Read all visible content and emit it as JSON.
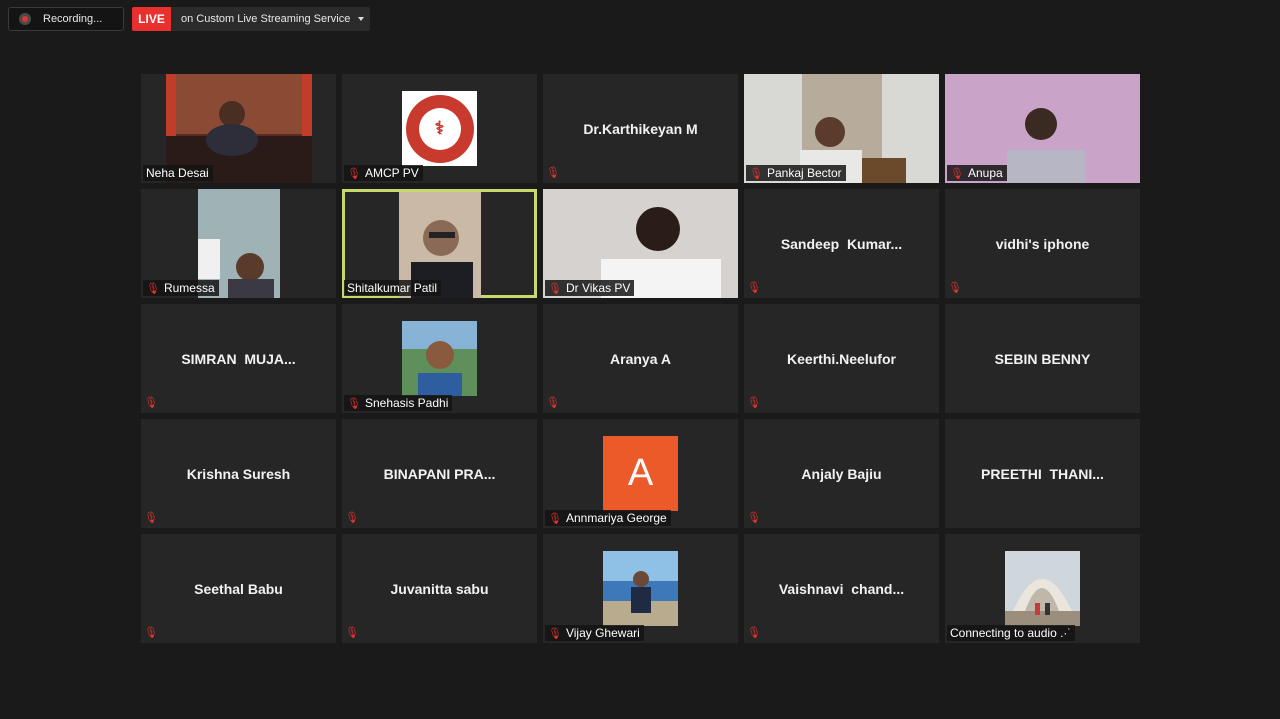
{
  "topbar": {
    "recording_label": "Recording...",
    "live_badge": "LIVE",
    "live_service": "on Custom Live Streaming Service"
  },
  "colors": {
    "live_red": "#e8312f",
    "active_border": "#c7d96c",
    "tile_bg": "#262626"
  },
  "participants": [
    {
      "name": "Neha Desai",
      "label": "Neha Desai",
      "muted": false,
      "kind": "video"
    },
    {
      "name": "AMCP PV",
      "label": "AMCP PV",
      "muted": true,
      "kind": "logo"
    },
    {
      "name": "Dr.Karthikeyan M",
      "muted": true,
      "kind": "name"
    },
    {
      "name": "Pankaj Bector",
      "label": "Pankaj Bector",
      "muted": true,
      "kind": "video"
    },
    {
      "name": "Anupa",
      "label": "Anupa",
      "muted": true,
      "kind": "video"
    },
    {
      "name": "Rumessa",
      "label": "Rumessa",
      "muted": true,
      "kind": "video"
    },
    {
      "name": "Shitalkumar Patil",
      "label": "Shitalkumar Patil",
      "muted": false,
      "kind": "video",
      "active_speaker": true
    },
    {
      "name": "Dr Vikas PV",
      "label": "Dr Vikas PV",
      "muted": true,
      "kind": "video"
    },
    {
      "name": "Sandeep  Kumar...",
      "muted": true,
      "kind": "name"
    },
    {
      "name": "vidhi's iphone",
      "muted": true,
      "kind": "name"
    },
    {
      "name": "SIMRAN  MUJA...",
      "muted": true,
      "kind": "name"
    },
    {
      "name": "Snehasis Padhi",
      "label": "Snehasis Padhi",
      "muted": true,
      "kind": "photo"
    },
    {
      "name": "Aranya A",
      "muted": true,
      "kind": "name"
    },
    {
      "name": "Keerthi.Neelufor",
      "muted": true,
      "kind": "name"
    },
    {
      "name": "SEBIN BENNY",
      "muted": false,
      "kind": "name"
    },
    {
      "name": "Krishna Suresh",
      "muted": true,
      "kind": "name"
    },
    {
      "name": "BINAPANI PRA...",
      "muted": true,
      "kind": "name"
    },
    {
      "name": "Annmariya George",
      "label": "Annmariya George",
      "muted": true,
      "kind": "avatar",
      "avatar_letter": "A"
    },
    {
      "name": "Anjaly Bajiu",
      "muted": true,
      "kind": "name"
    },
    {
      "name": "PREETHI  THANI...",
      "muted": false,
      "kind": "name"
    },
    {
      "name": "Seethal Babu",
      "muted": true,
      "kind": "name"
    },
    {
      "name": "Juvanitta sabu",
      "muted": true,
      "kind": "name"
    },
    {
      "name": "Vijay Ghewari",
      "label": "Vijay Ghewari",
      "muted": true,
      "kind": "photo"
    },
    {
      "name": "Vaishnavi  chand...",
      "muted": true,
      "kind": "name"
    },
    {
      "name": "Connecting to audio",
      "label": "Connecting to audio .·˙",
      "muted": false,
      "kind": "photo"
    }
  ]
}
